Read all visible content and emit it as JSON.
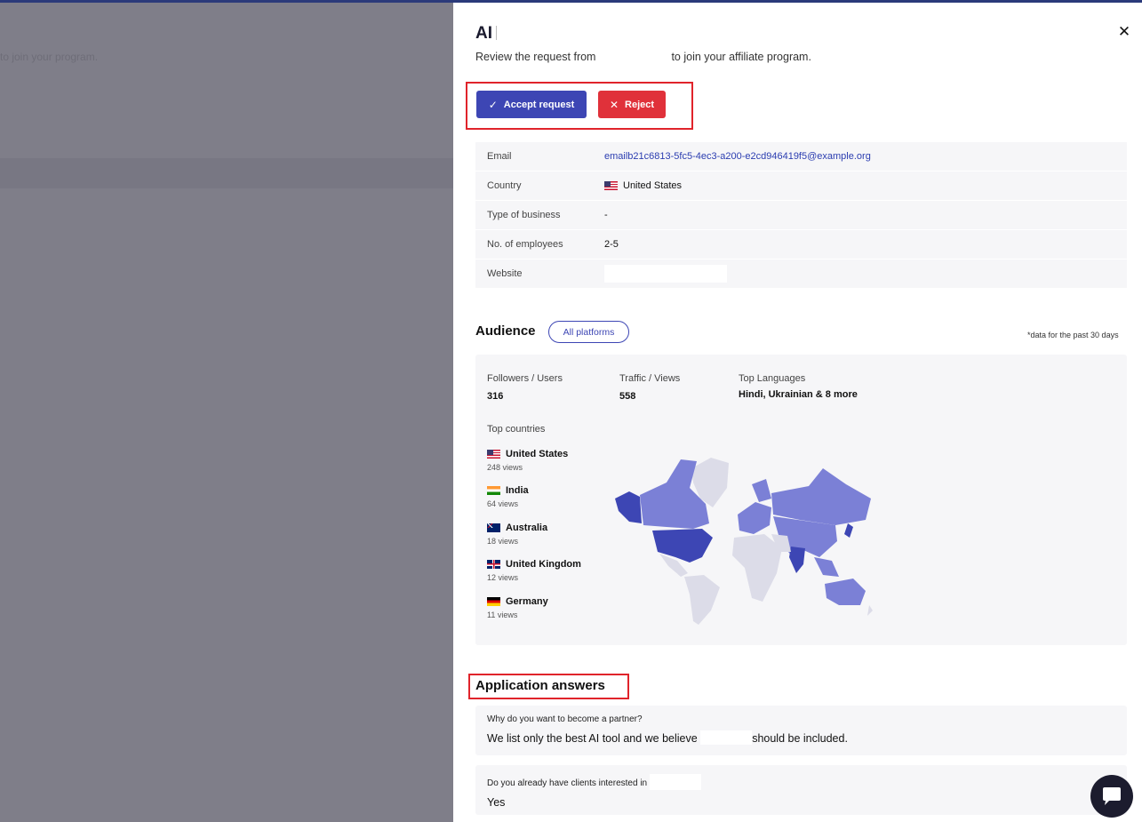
{
  "backdrop": {
    "text": "to join your program."
  },
  "drawer": {
    "title": "AI",
    "subtitle_start": "Review the request from",
    "subtitle_end": "to join your affiliate program.",
    "close_label": "✕"
  },
  "actions": {
    "accept_label": "Accept request",
    "reject_label": "Reject"
  },
  "info": {
    "rows": [
      {
        "key": "Email",
        "value": "emailb21c6813-5fc5-4ec3-a200-e2cd946419f5@example.org"
      },
      {
        "key": "Country",
        "value": "United States"
      },
      {
        "key": "Type of business",
        "value": "-"
      },
      {
        "key": "No. of employees",
        "value": "2-5"
      },
      {
        "key": "Website",
        "value": ""
      }
    ]
  },
  "audience": {
    "title": "Audience",
    "platform_filter": "All platforms",
    "note": "*data for the past 30 days",
    "metrics": [
      {
        "label": "Followers / Users",
        "value": "316"
      },
      {
        "label": "Traffic / Views",
        "value": "558"
      },
      {
        "label": "Top Languages",
        "value": "Hindi, Ukrainian & 8 more"
      }
    ],
    "top_countries_label": "Top countries",
    "countries": [
      {
        "name": "United States",
        "views": "248 views",
        "flag": "us-flag"
      },
      {
        "name": "India",
        "views": "64 views",
        "flag": "in-flag"
      },
      {
        "name": "Australia",
        "views": "18 views",
        "flag": "au-flag"
      },
      {
        "name": "United Kingdom",
        "views": "12 views",
        "flag": "uk-flag"
      },
      {
        "name": "Germany",
        "views": "11 views",
        "flag": "de-flag"
      }
    ],
    "map_colors": {
      "strong": "#3d46b4",
      "medium": "#7b80d6",
      "light": "#dcdce8"
    }
  },
  "answers": {
    "title": "Application answers",
    "items": [
      {
        "question": "Why do you want to become a partner?",
        "answer_start": "We list only the best AI tool and we believe",
        "answer_end": "should be included."
      },
      {
        "question": "Do you already have clients interested in",
        "answer_start": "Yes",
        "answer_end": ""
      }
    ]
  },
  "colors": {
    "accent": "#3d46b4",
    "danger": "#e0313a",
    "highlight": "#e0242b"
  }
}
